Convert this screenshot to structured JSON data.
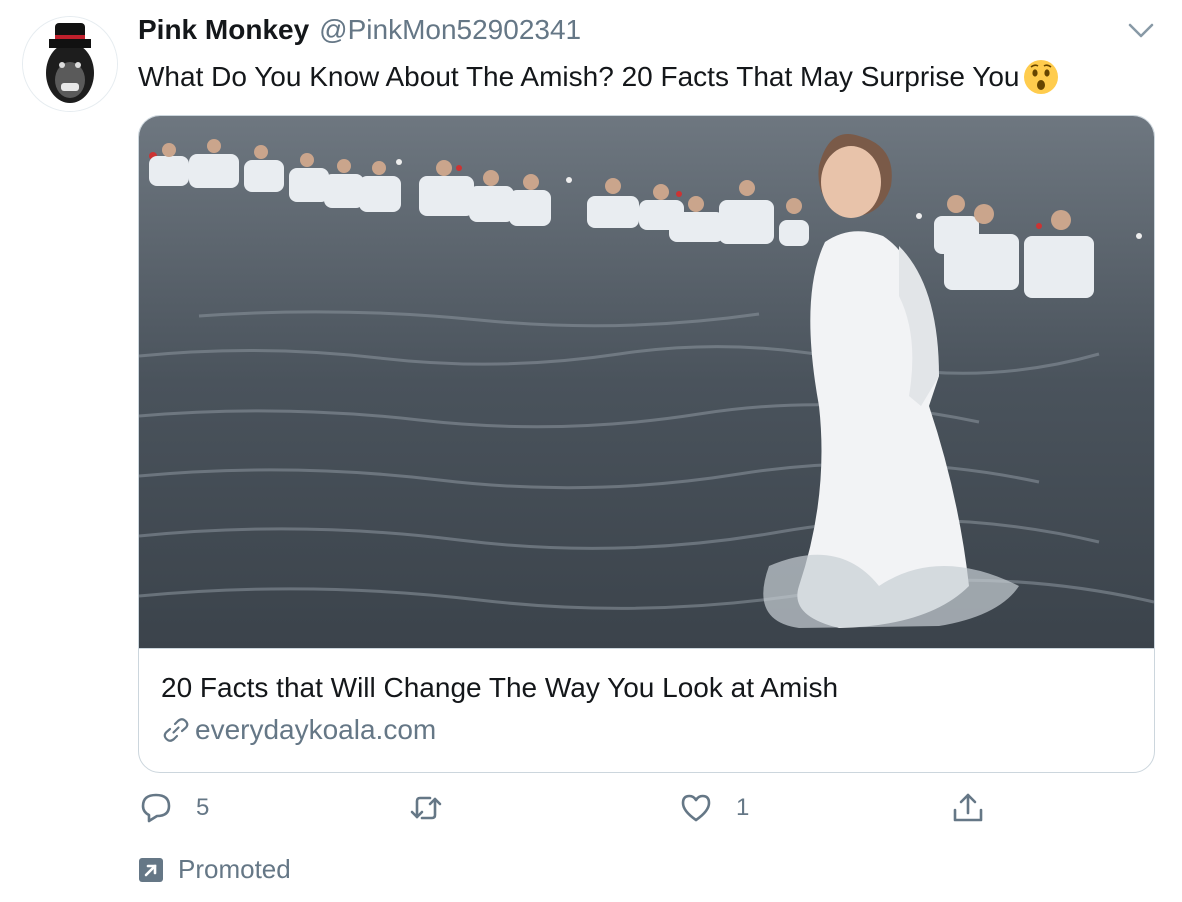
{
  "tweet": {
    "author": {
      "display_name": "Pink Monkey",
      "handle": "@PinkMon52902341",
      "avatar_icon": "chimp-with-hat-avatar"
    },
    "text": "What Do You Know About The Amish? 20 Facts That May Surprise You",
    "emoji": "astonished-face-emoji",
    "card": {
      "image_icon": "baptism-in-water-photo",
      "title": "20 Facts that Will Change The Way You Look at Amish",
      "domain": "everydaykoala.com"
    },
    "actions": {
      "reply_count": "5",
      "retweet_count": "",
      "like_count": "1"
    },
    "promoted_label": "Promoted"
  },
  "colors": {
    "text_primary": "#14171a",
    "text_secondary": "#657786",
    "border": "#ccd6dd"
  }
}
